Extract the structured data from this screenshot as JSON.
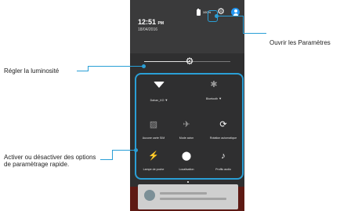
{
  "status": {
    "battery": "100%",
    "time": "12:51",
    "ampm": "PM",
    "date": "18/04/2016"
  },
  "callouts": {
    "settings": "Ouvrir les Paramètres",
    "brightness": "Régler la luminosité",
    "quick_settings_line1": "Activer ou désactiver des options",
    "quick_settings_line2": "de paramètrage rapide."
  },
  "tiles": {
    "wifi": "Dahan_KO",
    "bluetooth": "Bluetooth",
    "sim": "Aucune carte SIM",
    "airplane": "Mode avion",
    "rotation": "Rotation automatique",
    "flashlight": "Lampe de poche",
    "location": "Localisation",
    "audio": "Profils audio"
  },
  "accent_color": "#2a9fd6"
}
